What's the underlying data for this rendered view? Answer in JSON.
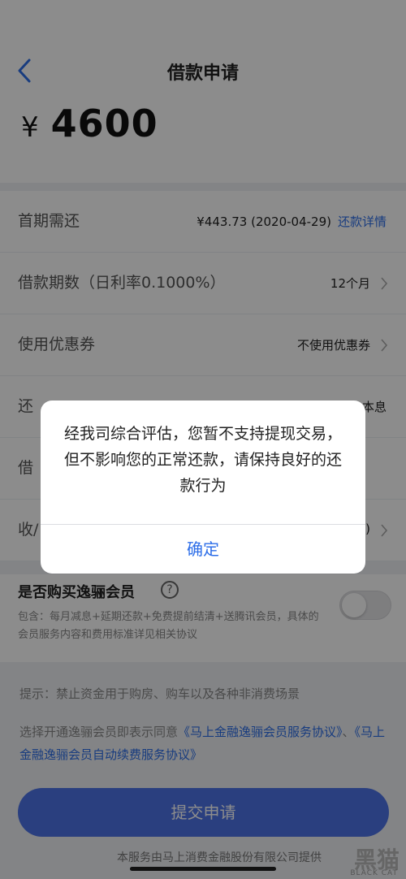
{
  "nav": {
    "title": "借款申请",
    "back_icon": "chevron-left-icon"
  },
  "amount": {
    "currency": "¥",
    "value": "4600"
  },
  "rows": [
    {
      "label": "首期需还",
      "value": "¥443.73  (2020-04-29)",
      "link": "还款详情"
    },
    {
      "label": "借款期数（日利率0.1000%）",
      "value": "12个月"
    },
    {
      "label": "使用优惠券",
      "value": "不使用优惠券"
    },
    {
      "label": "还",
      "value": "本息"
    },
    {
      "label": "借",
      "value": ""
    },
    {
      "label": "收/",
      "value": ")"
    }
  ],
  "member": {
    "title": "是否购买逸骊会员",
    "help_icon": "?",
    "description": "包含：每月减息+延期还款+免费提前结清+送腾讯会员，具体的会员服务内容和费用标准详见相关协议",
    "toggle_on": false
  },
  "tip": "提示：禁止资金用于购房、购车以及各种非消费场景",
  "agreement": {
    "prefix": "选择开通逸骊会员即表示同意",
    "link1": "《马上金融逸骊会员服务协议》",
    "sep": "、",
    "link2": "《马上金融逸骊会员自动续费服务协议》"
  },
  "submit_label": "提交申请",
  "footer": "本服务由马上消费金融股份有限公司提供",
  "watermark": {
    "text": "黑猫",
    "sub": "BLACK CAT"
  },
  "dialog": {
    "message": "经我司综合评估，您暂不支持提现交易，但不影响您的正常还款，请保持良好的还款行为",
    "confirm_label": "确定"
  },
  "colors": {
    "accent": "#2d6ee8",
    "button": "#4e74e8"
  }
}
